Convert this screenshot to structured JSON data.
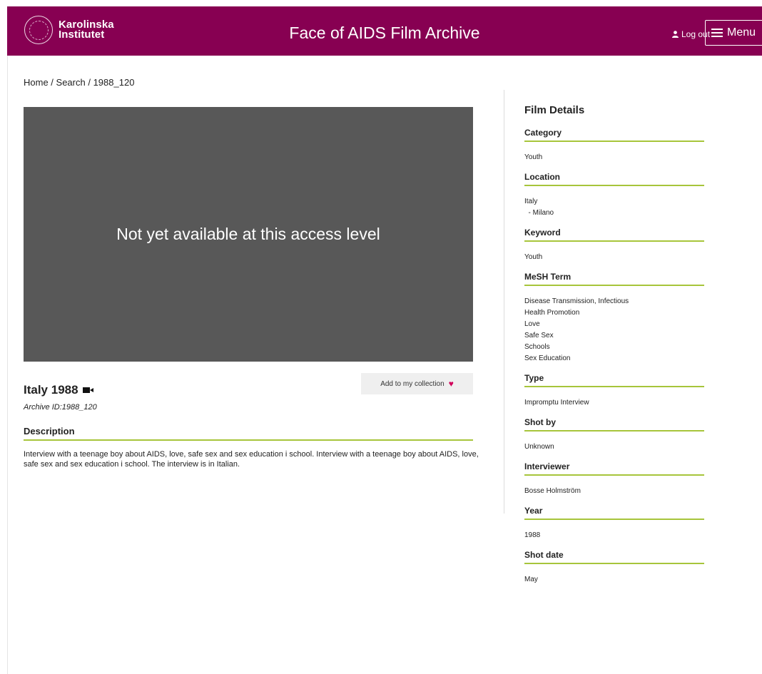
{
  "header": {
    "logo_line1": "Karolinska",
    "logo_line2": "Institutet",
    "site_title": "Face of AIDS Film Archive",
    "logout_label": "Log out",
    "menu_label": "Menu",
    "bg_color": "#870052"
  },
  "breadcrumb": [
    "Home",
    "Search",
    "1988_120"
  ],
  "video": {
    "message": "Not yet available at this access level"
  },
  "film": {
    "title": "Italy 1988",
    "archive_id": "Archive ID:1988_120",
    "add_to_collection_label": "Add to my collection",
    "description_heading": "Description",
    "description": "Interview with a teenage boy about AIDS, love, safe sex and sex education i school. Interview with a teenage boy about AIDS, love, safe sex and sex education i school. The interview is in Italian."
  },
  "details": {
    "title": "Film Details",
    "accent_color": "#a7c53b",
    "sections": [
      {
        "label": "Category",
        "values": [
          "Youth"
        ]
      },
      {
        "label": "Location",
        "values": [
          "Italy",
          "  - Milano"
        ]
      },
      {
        "label": "Keyword",
        "values": [
          "Youth"
        ]
      },
      {
        "label": "MeSH Term",
        "values": [
          "Disease Transmission, Infectious",
          "Health Promotion",
          "Love",
          "Safe Sex",
          "Schools",
          "Sex Education"
        ]
      },
      {
        "label": "Type",
        "values": [
          "Impromptu Interview"
        ]
      },
      {
        "label": "Shot by",
        "values": [
          "Unknown"
        ]
      },
      {
        "label": "Interviewer",
        "values": [
          "Bosse Holmström"
        ]
      },
      {
        "label": "Year",
        "values": [
          "1988"
        ]
      },
      {
        "label": "Shot date",
        "values": [
          "May"
        ]
      }
    ]
  }
}
